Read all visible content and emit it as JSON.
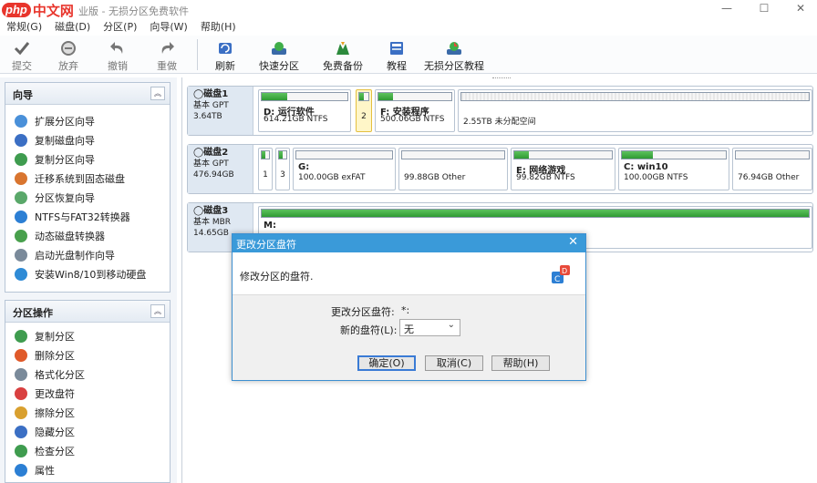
{
  "window": {
    "brand": "中文网",
    "brand_prefix": "php",
    "title": "业版 - 无损分区免费软件",
    "minimize": "—",
    "maximize": "☐",
    "close": "✕"
  },
  "menu": [
    "常规(G)",
    "磁盘(D)",
    "分区(P)",
    "向导(W)",
    "帮助(H)"
  ],
  "toolbar": [
    {
      "label": "提交",
      "icon": "check-icon",
      "disabled": true
    },
    {
      "label": "放弃",
      "icon": "discard-icon",
      "disabled": true
    },
    {
      "label": "撤销",
      "icon": "undo-icon",
      "disabled": true
    },
    {
      "label": "重做",
      "icon": "redo-icon",
      "disabled": true
    },
    {
      "label": "刷新",
      "icon": "refresh-icon",
      "disabled": false
    },
    {
      "label": "快速分区",
      "icon": "quick-partition-icon",
      "disabled": false
    },
    {
      "label": "免费备份",
      "icon": "backup-icon",
      "disabled": false
    },
    {
      "label": "教程",
      "icon": "tutorial-icon",
      "disabled": false
    },
    {
      "label": "无损分区教程",
      "icon": "lossless-tutorial-icon",
      "disabled": false
    }
  ],
  "wizard_panel": {
    "title": "向导",
    "items": [
      {
        "label": "扩展分区向导",
        "color": "#4a90d9"
      },
      {
        "label": "复制磁盘向导",
        "color": "#3b6fc4"
      },
      {
        "label": "复制分区向导",
        "color": "#3f9c4f"
      },
      {
        "label": "迁移系统到固态磁盘",
        "color": "#d9752f"
      },
      {
        "label": "分区恢复向导",
        "color": "#5aa86a"
      },
      {
        "label": "NTFS与FAT32转换器",
        "color": "#2c7fd4"
      },
      {
        "label": "动态磁盘转换器",
        "color": "#48a04c"
      },
      {
        "label": "启动光盘制作向导",
        "color": "#7a8a9a"
      },
      {
        "label": "安装Win8/10到移动硬盘",
        "color": "#2f8bd6"
      }
    ]
  },
  "partition_panel": {
    "title": "分区操作",
    "items": [
      {
        "label": "复制分区",
        "color": "#3f9c4f"
      },
      {
        "label": "删除分区",
        "color": "#e05a2a"
      },
      {
        "label": "格式化分区",
        "color": "#7a8a9a"
      },
      {
        "label": "更改盘符",
        "color": "#d94040"
      },
      {
        "label": "擦除分区",
        "color": "#d9a02f"
      },
      {
        "label": "隐藏分区",
        "color": "#3b6fc4"
      },
      {
        "label": "检查分区",
        "color": "#3f9c4f"
      },
      {
        "label": "属性",
        "color": "#2c7fd4"
      }
    ]
  },
  "disks": [
    {
      "name": "磁盘1",
      "type": "基本 GPT",
      "size": "3.64TB",
      "partitions": [
        {
          "label": "D: 运行软件",
          "detail": "614.21GB NTFS",
          "used": 0.3
        },
        {
          "label": "",
          "detail": "2",
          "used": 0.5,
          "selected": true
        },
        {
          "label": "F: 安装程序",
          "detail": "500.06GB NTFS",
          "used": 0.2
        },
        {
          "label": "",
          "detail": "2.55TB 未分配空间",
          "used": 0,
          "unalloc": true
        }
      ]
    },
    {
      "name": "磁盘2",
      "type": "基本 GPT",
      "size": "476.94GB",
      "partitions": [
        {
          "label": "",
          "detail": "1",
          "used": 0.5
        },
        {
          "label": "",
          "detail": "3",
          "used": 0.5
        },
        {
          "label": "G:",
          "detail": "100.00GB exFAT",
          "used": 0
        },
        {
          "label": "",
          "detail": "99.88GB Other",
          "used": 0
        },
        {
          "label": "E: 网络游戏",
          "detail": "99.82GB NTFS",
          "used": 0.15
        },
        {
          "label": "C: win10",
          "detail": "100.00GB NTFS",
          "used": 0.3
        },
        {
          "label": "",
          "detail": "76.94GB Other",
          "used": 0
        }
      ]
    },
    {
      "name": "磁盘3",
      "type": "基本 MBR",
      "size": "14.65GB",
      "partitions": [
        {
          "label": "M:",
          "detail": "",
          "used": 1
        }
      ]
    }
  ],
  "dialog": {
    "title": "更改分区盘符",
    "close": "✕",
    "message": "修改分区的盘符.",
    "current_label": "更改分区盘符:",
    "current_value": "*:",
    "new_label": "新的盘符(L):",
    "new_value": "无",
    "ok": "确定(O)",
    "cancel": "取消(C)",
    "help": "帮助(H)"
  }
}
